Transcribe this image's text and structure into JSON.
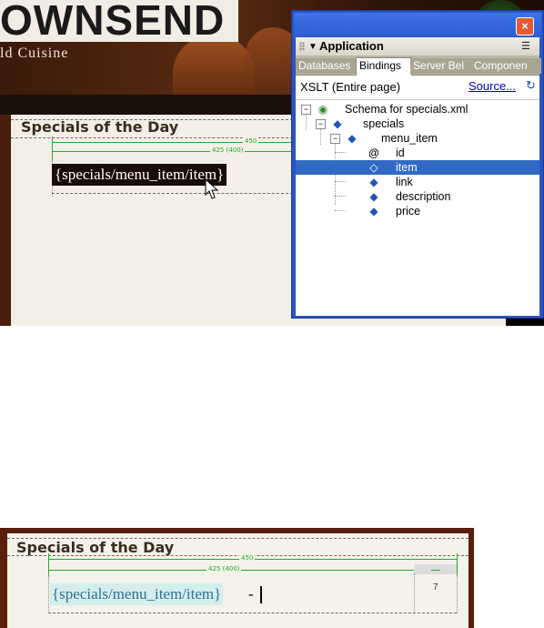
{
  "top_shot": {
    "brand": "OWNSEND",
    "tagline": "ld Cuisine",
    "section_heading": "Specials of the Day",
    "ruler_outer": "450",
    "ruler_inner": "425 (400)",
    "binding_token": "{specials/menu_item/item}"
  },
  "panel": {
    "close_glyph": "×",
    "title": "Application",
    "tabs": [
      {
        "label": "Databases",
        "active": false
      },
      {
        "label": "Bindings",
        "active": true
      },
      {
        "label": "Server Bel",
        "active": false
      },
      {
        "label": "Componen",
        "active": false
      }
    ],
    "source_scope": "XSLT (Entire page)",
    "source_link": "Source...",
    "tree": [
      {
        "label": "Schema for specials.xml",
        "icon": "schema-icon",
        "depth": 0,
        "expander": "−"
      },
      {
        "label": "specials",
        "icon": "element-icon",
        "depth": 1,
        "expander": "−"
      },
      {
        "label": "menu_item",
        "icon": "repeating-element-icon",
        "depth": 2,
        "expander": "−"
      },
      {
        "label": "id",
        "icon": "attribute-icon",
        "depth": 3,
        "expander": ""
      },
      {
        "label": "item",
        "icon": "element-icon",
        "depth": 3,
        "expander": "",
        "selected": true
      },
      {
        "label": "link",
        "icon": "element-icon",
        "depth": 3,
        "expander": ""
      },
      {
        "label": "description",
        "icon": "element-icon",
        "depth": 3,
        "expander": ""
      },
      {
        "label": "price",
        "icon": "element-icon",
        "depth": 3,
        "expander": ""
      }
    ]
  },
  "bottom_shot": {
    "section_heading": "Specials of the Day",
    "ruler_outer": "450",
    "ruler_inner": "425 (400)",
    "binding_token": "{specials/menu_item/item}",
    "separator": "-",
    "cell_number": "7"
  },
  "colors": {
    "panel_blue": "#2a54c4",
    "selection": "#316ac5",
    "ruler_green": "#22aa33",
    "brown_frame": "#5a1c0c"
  }
}
